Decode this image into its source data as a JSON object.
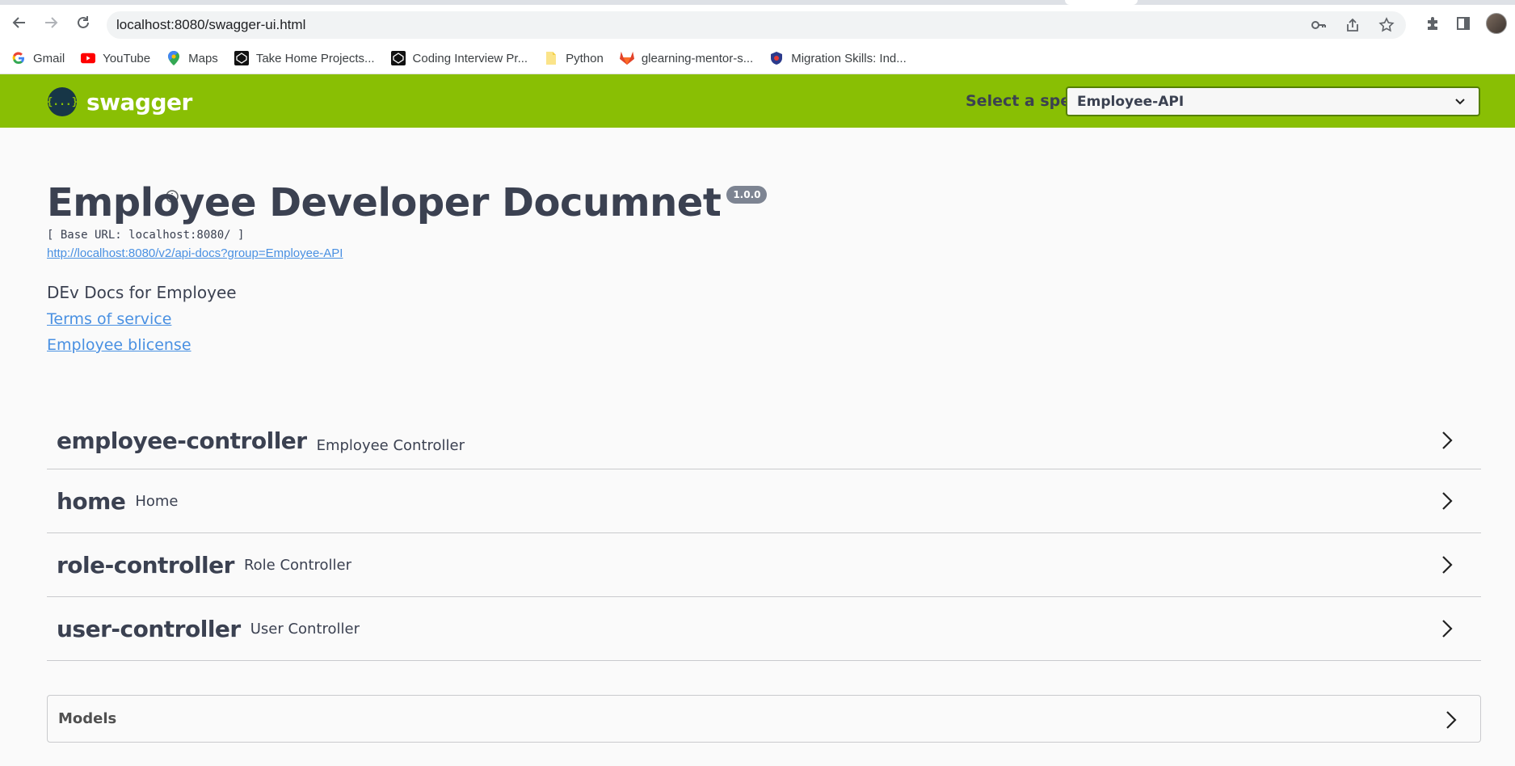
{
  "browser": {
    "url": "localhost:8080/swagger-ui.html",
    "bookmarks": [
      {
        "label": "Gmail",
        "icon": "google-icon"
      },
      {
        "label": "YouTube",
        "icon": "youtube-icon"
      },
      {
        "label": "Maps",
        "icon": "maps-icon"
      },
      {
        "label": "Take Home Projects...",
        "icon": "codepen-icon"
      },
      {
        "label": "Coding Interview Pr...",
        "icon": "codepen-icon"
      },
      {
        "label": "Python",
        "icon": "folder-icon"
      },
      {
        "label": "glearning-mentor-s...",
        "icon": "gitlab-icon"
      },
      {
        "label": "Migration Skills: Ind...",
        "icon": "shield-icon"
      }
    ]
  },
  "topbar": {
    "logo_text": "swagger",
    "logo_glyph": "{...}",
    "spec_label": "Select a spec",
    "spec_selected": "Employee-API",
    "color": "#89bf04"
  },
  "info": {
    "title": "Employee Developer Documnet",
    "version": "1.0.0",
    "base_url": "[ Base URL: localhost:8080/ ]",
    "spec_link": "http://localhost:8080/v2/api-docs?group=Employee-API",
    "description": "DEv Docs for Employee",
    "terms_link": "Terms of service",
    "license_link": "Employee blicense"
  },
  "tags": [
    {
      "name": "employee-controller",
      "description": "Employee Controller"
    },
    {
      "name": "home",
      "description": "Home"
    },
    {
      "name": "role-controller",
      "description": "Role Controller"
    },
    {
      "name": "user-controller",
      "description": "User Controller"
    }
  ],
  "models": {
    "title": "Models"
  }
}
